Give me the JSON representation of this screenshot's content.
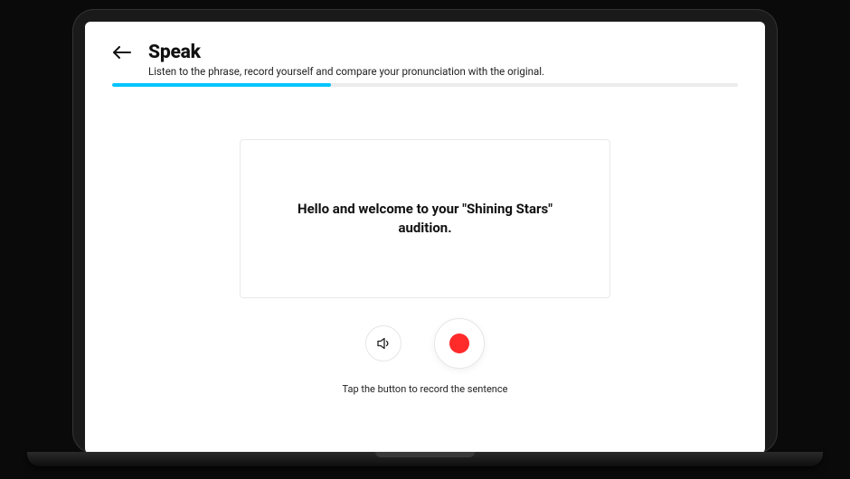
{
  "header": {
    "title": "Speak",
    "subtitle": "Listen to the phrase, record yourself and compare your pronunciation with the original."
  },
  "progress": {
    "percent": 35
  },
  "card": {
    "phrase": "Hello and welcome to your \"Shining Stars\" audition."
  },
  "controls": {
    "hint": "Tap the button to record the sentence"
  }
}
